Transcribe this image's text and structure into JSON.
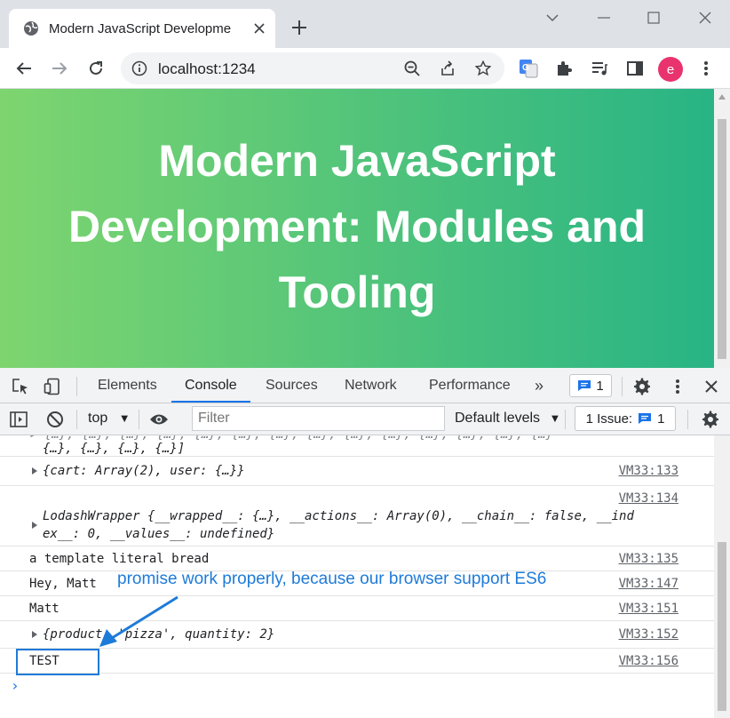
{
  "browser": {
    "tab_title": "Modern JavaScript Developme",
    "url": "localhost:1234",
    "avatar_letter": "e"
  },
  "page": {
    "title": "Modern JavaScript Development: Modules and Tooling"
  },
  "devtools": {
    "tabs": [
      "Elements",
      "Console",
      "Sources",
      "Network",
      "Performance"
    ],
    "active_tab": "Console",
    "more_tabs": "»",
    "messages_badge": "1",
    "context": "top",
    "filter_placeholder": "Filter",
    "levels": "Default levels",
    "issues_label": "1 Issue:",
    "issues_count": "1"
  },
  "console": {
    "row0_line1": "▸ {…}, {…}, {…}, {…}, {…}, {…}, {…}, {…}, {…}, {…}, {…}, {…}, {…}, {…}",
    "row0_line2": "{…}, {…}, {…}, {…}]",
    "row1_text": "{cart: Array(2), user: {…}}",
    "row1_src": "VM33:133",
    "row2_src": "VM33:134",
    "row2_line1": "LodashWrapper {__wrapped__: {…}, __actions__: Array(0), __chain__: false, __ind",
    "row2_line2": "ex__: 0, __values__: undefined}",
    "row3_text": "a template literal bread",
    "row3_src": "VM33:135",
    "row4_text": "Hey, Matt",
    "row4_src": "VM33:147",
    "row5_text": "Matt",
    "row5_src": "VM33:151",
    "row6_text": "{product: 'pizza', quantity: 2}",
    "row6_src": "VM33:152",
    "row7_text": "TEST",
    "row7_src": "VM33:156",
    "prompt": "›"
  },
  "annotation": {
    "text": "promise work properly, because our browser support ES6"
  },
  "colors": {
    "accent": "#1a73e8",
    "annotation": "#1e7bd8",
    "gradient_start": "#7ed56f",
    "gradient_end": "#28b485"
  }
}
